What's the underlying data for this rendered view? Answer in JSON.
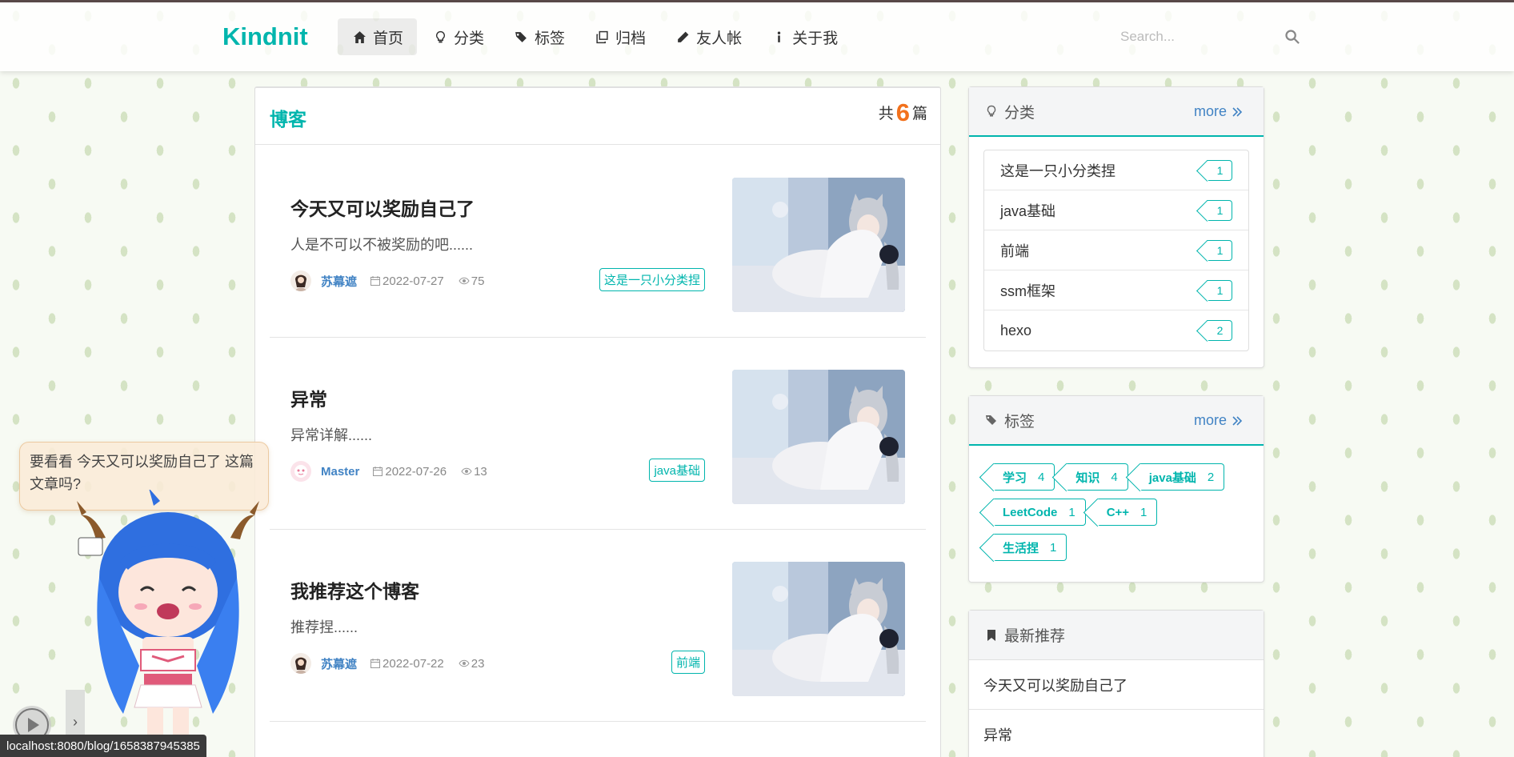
{
  "brand": "Kindnit",
  "nav": {
    "items": [
      {
        "label": "首页",
        "icon": "home-icon"
      },
      {
        "label": "分类",
        "icon": "lightbulb-icon"
      },
      {
        "label": "标签",
        "icon": "tags-icon"
      },
      {
        "label": "归档",
        "icon": "clone-icon"
      },
      {
        "label": "友人帐",
        "icon": "pencil-icon"
      },
      {
        "label": "关于我",
        "icon": "info-icon"
      }
    ],
    "search_placeholder": "Search..."
  },
  "main": {
    "title": "博客",
    "count_prefix": "共",
    "count": "6",
    "count_suffix": "篇",
    "posts": [
      {
        "title": "今天又可以奖励自己了",
        "desc": "人是不可以不被奖励的吧......",
        "author": "苏幕遮",
        "date": "2022-07-27",
        "views": "75",
        "category": "这是一只小分类捏"
      },
      {
        "title": "异常",
        "desc": "异常详解......",
        "author": "Master",
        "date": "2022-07-26",
        "views": "13",
        "category": "java基础"
      },
      {
        "title": "我推荐这个博客",
        "desc": "推荐捏......",
        "author": "苏幕遮",
        "date": "2022-07-22",
        "views": "23",
        "category": "前端"
      }
    ]
  },
  "sidebar": {
    "categories": {
      "title": "分类",
      "more": "more",
      "items": [
        {
          "name": "这是一只小分类捏",
          "count": "1"
        },
        {
          "name": "java基础",
          "count": "1"
        },
        {
          "name": "前端",
          "count": "1"
        },
        {
          "name": "ssm框架",
          "count": "1"
        },
        {
          "name": "hexo",
          "count": "2"
        }
      ]
    },
    "tags": {
      "title": "标签",
      "more": "more",
      "items": [
        {
          "name": "学习",
          "count": "4"
        },
        {
          "name": "知识",
          "count": "4"
        },
        {
          "name": "java基础",
          "count": "2"
        },
        {
          "name": "LeetCode",
          "count": "1"
        },
        {
          "name": "C++",
          "count": "1"
        },
        {
          "name": "生活捏",
          "count": "1"
        }
      ]
    },
    "recommend": {
      "title": "最新推荐",
      "items": [
        "今天又可以奖励自己了",
        "异常"
      ]
    }
  },
  "mascot": {
    "bubble": "要看看 今天又可以奖励自己了 这篇文章吗?"
  },
  "statusbar": "localhost:8080/blog/1658387945385",
  "colors": {
    "accent": "#00b5ad",
    "link": "#4183c4",
    "count": "#f2711c"
  }
}
